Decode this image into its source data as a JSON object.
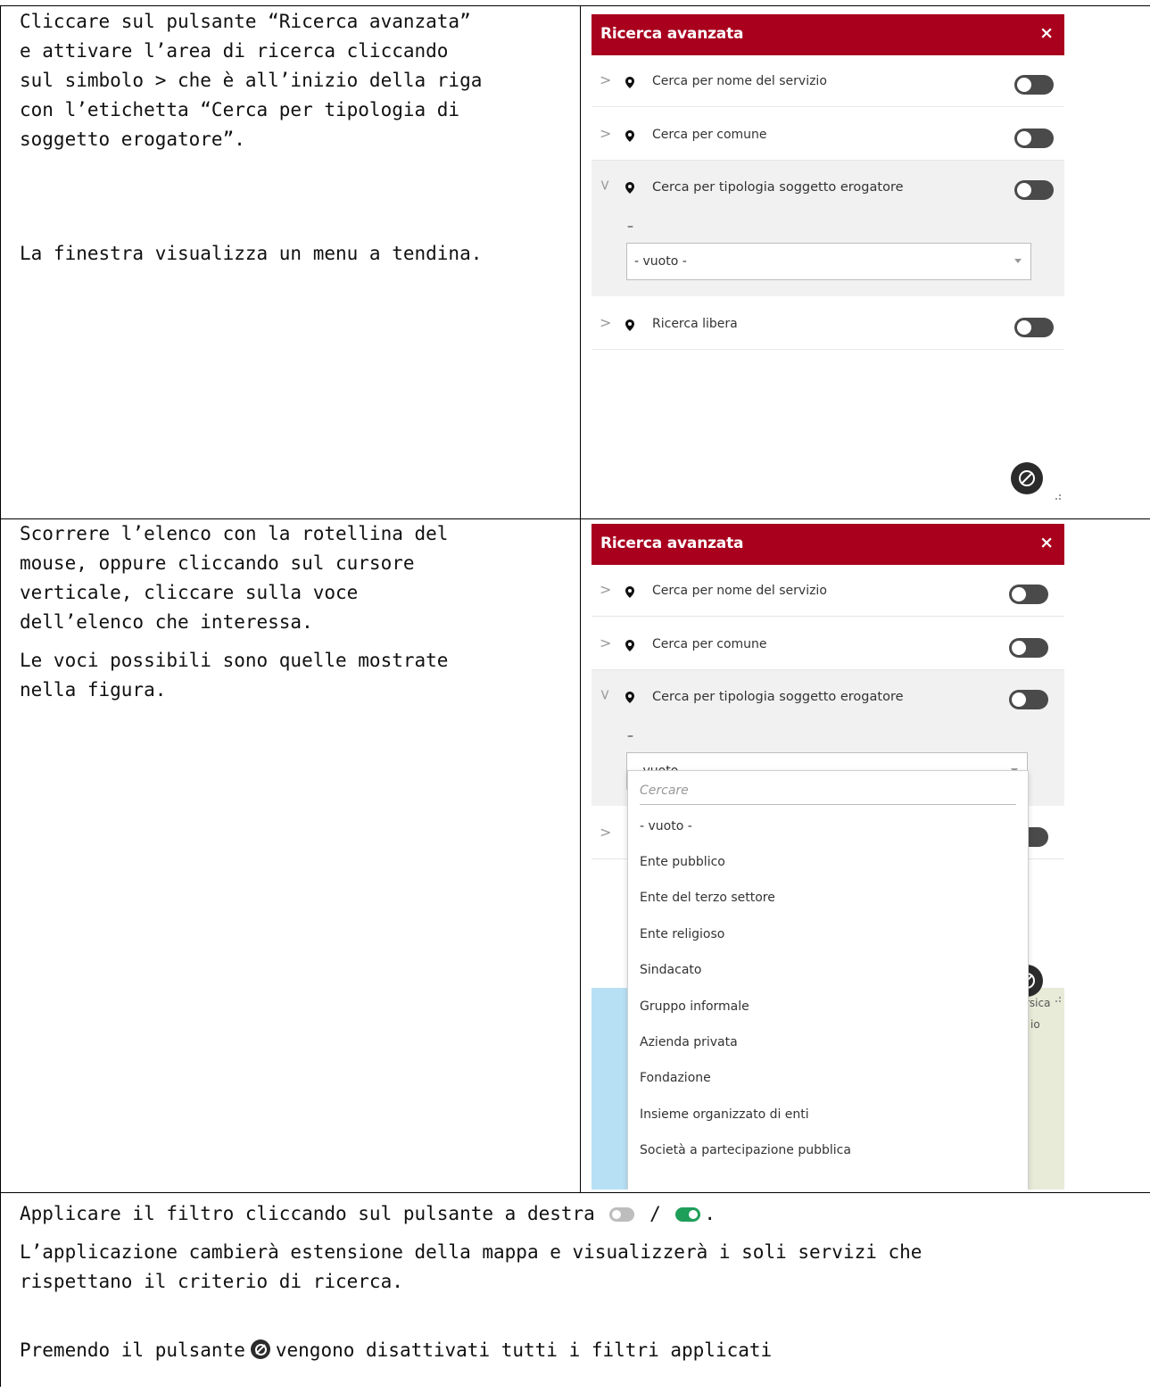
{
  "rows": [
    {
      "instructions": [
        "Cliccare sul pulsante “Ricerca avanzata”",
        "e attivare l’area di ricerca cliccando",
        "sul simbolo > che è all’inizio della riga",
        "con l’etichetta “Cerca per tipologia di",
        "soggetto erogatore”.",
        "La finestra visualizza un menu a tendina."
      ]
    },
    {
      "instructions": [
        "Scorrere l’elenco con la rotellina del",
        "mouse, oppure cliccando sul cursore",
        "verticale, cliccare sulla voce",
        "dell’elenco che interessa.",
        "Le voci possibili sono quelle mostrate",
        "nella figura."
      ]
    },
    {
      "instructions": [
        "Applicare il filtro cliccando sul pulsante a destra",
        "/",
        ".",
        "L’applicazione cambierà estensione della mappa e visualizzerà i soli servizi che",
        "rispettano il criterio di ricerca.",
        "Premendo il pulsante",
        "vengono disattivati tutti i filtri applicati"
      ]
    }
  ],
  "panel": {
    "title": "Ricerca avanzata",
    "close": "×",
    "header_color": "#a8001d",
    "items": [
      {
        "label": "Cerca per nome del servizio"
      },
      {
        "label": "Cerca per comune"
      },
      {
        "label": "Cerca per tipologia soggetto erogatore"
      },
      {
        "label": "Ricerca libera"
      }
    ],
    "dash": "–",
    "select_value": "- vuoto -",
    "icons": {
      "chevron": "chevron-right-icon",
      "pin": "map-pin-icon",
      "reset": "clear-filters-icon"
    }
  },
  "dropdown": {
    "placeholder": "Cercare",
    "options": [
      "- vuoto -",
      "Ente pubblico",
      "Ente del terzo settore",
      "Ente religioso",
      "Sindacato",
      "Gruppo informale",
      "Azienda privata",
      "Fondazione",
      "Insieme organizzato di enti",
      "Società a partecipazione pubblica"
    ]
  },
  "map": {
    "labels": [
      "rsica",
      "io"
    ]
  },
  "colors": {
    "toggle_off": "#bdbdbd",
    "toggle_on": "#1f9e5a",
    "toggle_dark": "#4a4a4a"
  }
}
